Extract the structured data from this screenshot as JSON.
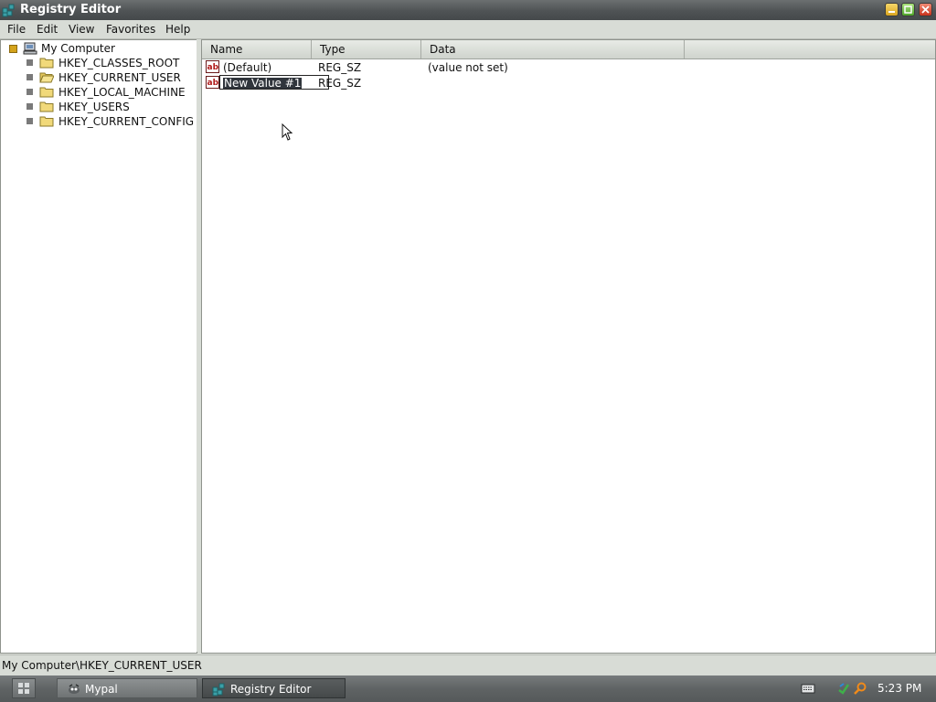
{
  "window": {
    "title": "Registry Editor",
    "controls": {
      "minimize": "minimize",
      "maximize": "maximize",
      "close": "close"
    }
  },
  "menu": [
    "File",
    "Edit",
    "View",
    "Favorites",
    "Help"
  ],
  "tree": {
    "root": "My Computer",
    "children": [
      "HKEY_CLASSES_ROOT",
      "HKEY_CURRENT_USER",
      "HKEY_LOCAL_MACHINE",
      "HKEY_USERS",
      "HKEY_CURRENT_CONFIG"
    ]
  },
  "list": {
    "columns": [
      "Name",
      "Type",
      "Data"
    ],
    "rows": [
      {
        "name": "(Default)",
        "type": "REG_SZ",
        "data": "(value not set)"
      },
      {
        "name": "New Value #1",
        "type": "REG_SZ",
        "data": "",
        "editing": true
      }
    ]
  },
  "status": {
    "path": "My Computer\\HKEY_CURRENT_USER"
  },
  "taskbar": {
    "tasks": [
      {
        "label": "Mypal",
        "active": false
      },
      {
        "label": "Registry Editor",
        "active": true
      }
    ],
    "clock": "5:23 PM"
  },
  "colors": {
    "titlebar": "#4f5355",
    "selection": "#30353c",
    "root_expander": "#d4a31b",
    "folder": "#f1d97a"
  }
}
